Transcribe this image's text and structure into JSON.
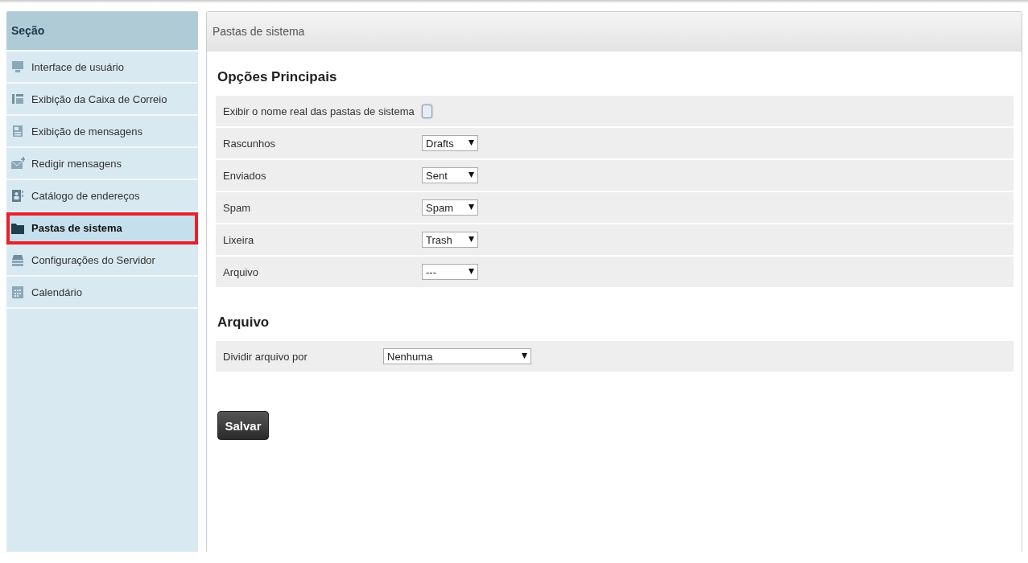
{
  "sidebar": {
    "title": "Seção",
    "items": [
      {
        "label": "Interface de usuário",
        "selected": false
      },
      {
        "label": "Exibição da Caixa de Correio",
        "selected": false
      },
      {
        "label": "Exibição de mensagens",
        "selected": false
      },
      {
        "label": "Redigir mensagens",
        "selected": false
      },
      {
        "label": "Catálogo de endereços",
        "selected": false
      },
      {
        "label": "Pastas de sistema",
        "selected": true
      },
      {
        "label": "Configurações do Servidor",
        "selected": false
      },
      {
        "label": "Calendário",
        "selected": false
      }
    ]
  },
  "panel": {
    "title": "Pastas de sistema",
    "sections": [
      {
        "title": "Opções Principais",
        "rows": [
          {
            "kind": "checkbox",
            "label": "Exibir o nome real das pastas de sistema",
            "checked": false
          },
          {
            "kind": "select",
            "label": "Rascunhos",
            "value": "Drafts"
          },
          {
            "kind": "select",
            "label": "Enviados",
            "value": "Sent"
          },
          {
            "kind": "select",
            "label": "Spam",
            "value": "Spam"
          },
          {
            "kind": "select",
            "label": "Lixeira",
            "value": "Trash"
          },
          {
            "kind": "select",
            "label": "Arquivo",
            "value": "---"
          }
        ]
      },
      {
        "title": "Arquivo",
        "rows": [
          {
            "kind": "wide-select",
            "label": "Dividir arquivo por",
            "value": "Nenhuma"
          }
        ]
      }
    ],
    "save_button": "Salvar"
  }
}
